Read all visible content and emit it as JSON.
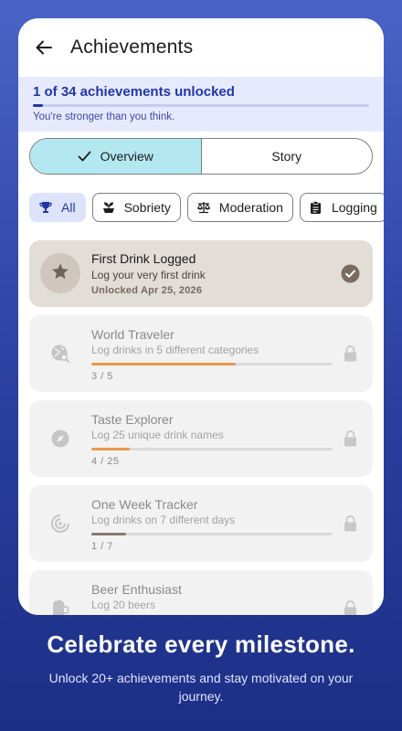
{
  "header": {
    "title": "Achievements",
    "back_icon": "arrow-left-icon"
  },
  "progress": {
    "title": "1 of 34 achievements unlocked",
    "subtitle": "You're stronger than you think.",
    "unlocked": 1,
    "total": 34
  },
  "segments": [
    {
      "label": "Overview",
      "active": true
    },
    {
      "label": "Story",
      "active": false
    }
  ],
  "filters": [
    {
      "label": "All",
      "icon": "trophy-icon",
      "active": true
    },
    {
      "label": "Sobriety",
      "icon": "sprout-icon",
      "active": false
    },
    {
      "label": "Moderation",
      "icon": "scale-icon",
      "active": false
    },
    {
      "label": "Logging",
      "icon": "clipboard-icon",
      "active": false
    }
  ],
  "achievements": [
    {
      "title": "First Drink Logged",
      "description": "Log your very first drink",
      "unlocked_text": "Unlocked Apr 25, 2026",
      "icon": "star-icon",
      "status_icon": "check-circle-icon"
    },
    {
      "title": "World Traveler",
      "description": "Log drinks in 5 different categories",
      "progress_text": "3 / 5",
      "progress": 0.6,
      "icon": "globe-search-icon",
      "status_icon": "lock-icon",
      "bar_color": "#e79a4e"
    },
    {
      "title": "Taste Explorer",
      "description": "Log 25 unique drink names",
      "progress_text": "4 / 25",
      "progress": 0.16,
      "icon": "compass-icon",
      "status_icon": "lock-icon",
      "bar_color": "#e79a4e"
    },
    {
      "title": "One Week Tracker",
      "description": "Log drinks on 7 different days",
      "progress_text": "1 / 7",
      "progress": 0.143,
      "icon": "radar-icon",
      "status_icon": "lock-icon",
      "bar_color": "#8a7a72"
    },
    {
      "title": "Beer Enthusiast",
      "description": "Log 20 beers",
      "icon": "beer-mug-icon",
      "status_icon": "lock-icon"
    }
  ],
  "promo": {
    "headline": "Celebrate every milestone.",
    "subtext": "Unlock 20+ achievements and stay motivated on your journey."
  },
  "colors": {
    "primary": "#2236a6",
    "segment_active": "#b3e8f1",
    "chip_active": "#dde3fb",
    "unlocked_card": "#e2ddd7",
    "locked_card": "#f2f2f2",
    "accent_orange": "#e79a4e",
    "background_gradient_top": "#4a63c6",
    "background_gradient_bottom": "#1c2f86"
  }
}
